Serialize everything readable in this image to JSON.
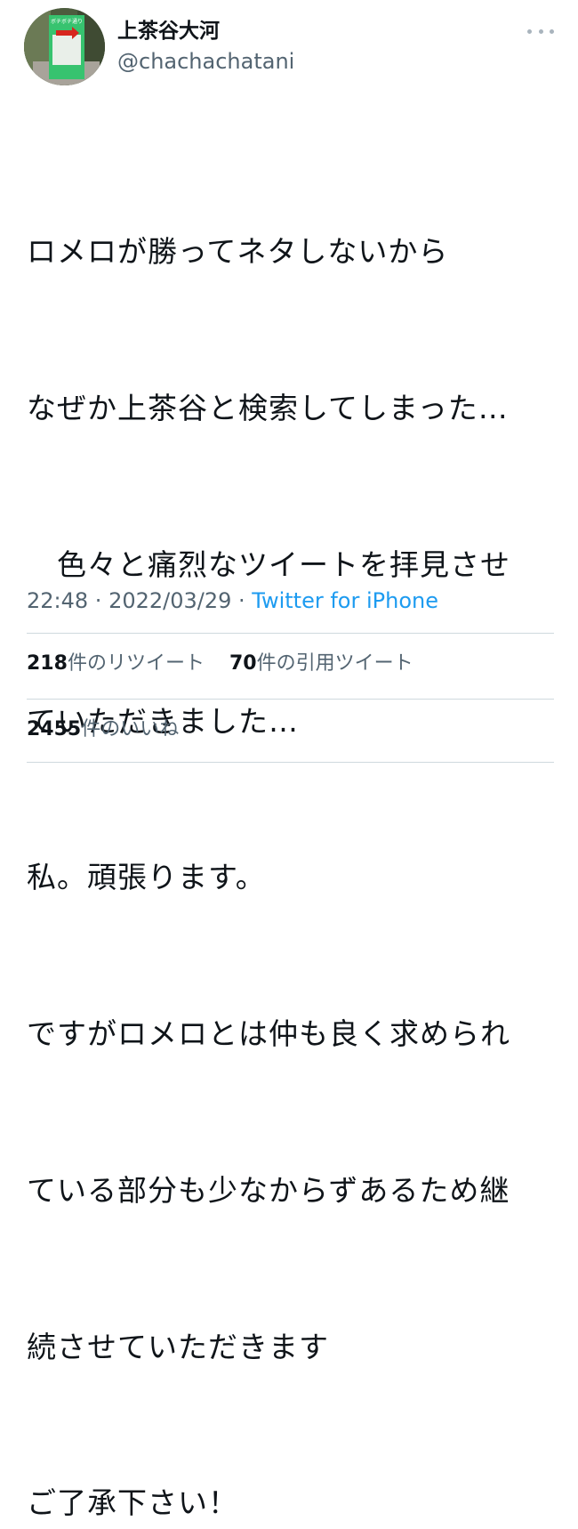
{
  "author": {
    "display_name": "上茶谷大河",
    "handle": "@chachachatani",
    "avatar_sign_text": "ボチボチ通り"
  },
  "tweet": {
    "lines": [
      "ロメロが勝ってネタしないから",
      "なぜか上茶谷と検索してしまった…",
      "　色々と痛烈なツイートを拝見させ",
      "ていただきました…",
      "私。頑張ります。",
      "ですがロメロとは仲も良く求められ",
      "ている部分も少なからずあるため継",
      "続させていただきます",
      "ご了承下さい！"
    ]
  },
  "meta": {
    "time": "22:48",
    "date": "2022/03/29",
    "separator": " · ",
    "source": "Twitter for iPhone"
  },
  "stats": {
    "retweets_count": "218",
    "retweets_label": "件のリツイート",
    "quotes_count": "70",
    "quotes_label": "件の引用ツイート",
    "likes_count": "2455",
    "likes_label": "件のいいね"
  },
  "colors": {
    "link": "#1d9bf0",
    "secondary_text": "#536471",
    "divider": "#cfd9de"
  },
  "icons": {
    "more": "more-horizontal-icon"
  }
}
